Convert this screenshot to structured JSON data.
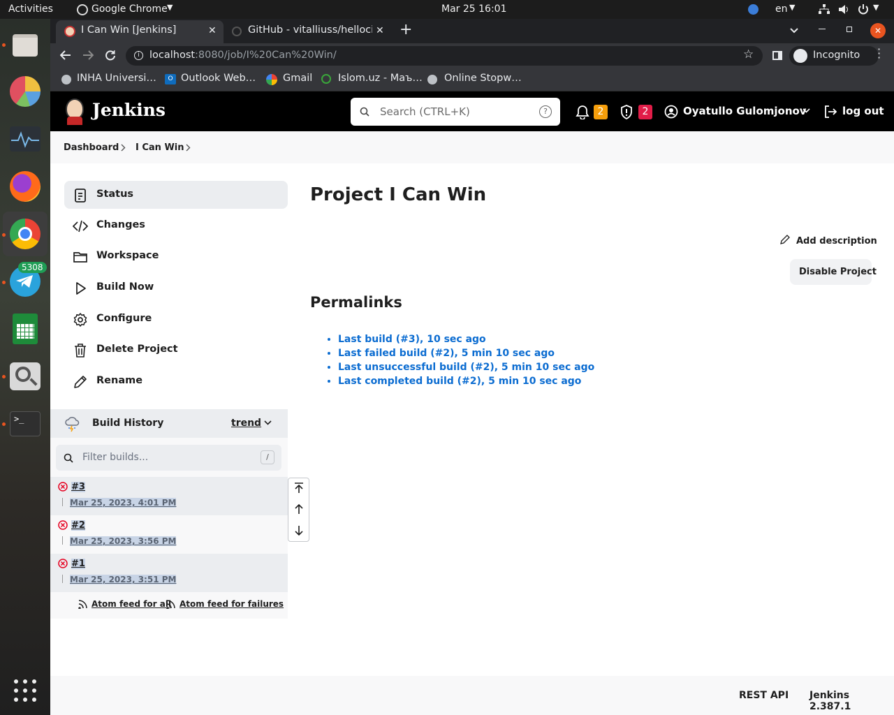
{
  "os_bar": {
    "activities": "Activities",
    "app_name": "Google Chrome",
    "datetime": "Mar 25  16:01",
    "lang": "en"
  },
  "dock": {
    "telegram_badge": "5308",
    "apps": [
      "files-icon",
      "pie-app-icon",
      "system-monitor-icon",
      "firefox-icon",
      "chrome-icon",
      "telegram-icon",
      "spreadsheet-icon",
      "image-viewer-icon",
      "terminal-icon",
      "app-grid-icon"
    ]
  },
  "browser": {
    "tabs": [
      {
        "label": "I Can Win [Jenkins]",
        "active": true
      },
      {
        "label": "GitHub - vitalliuss/helloci",
        "active": false
      }
    ],
    "url_host": "localhost",
    "url_rest": ":8080/job/I%20Can%20Win/",
    "profile": "Incognito",
    "bookmarks": [
      "INHA Universi…",
      "Outlook Web…",
      "Gmail",
      "Islom.uz - Маъ…",
      "Online Stopw…"
    ]
  },
  "jenkins": {
    "logo_text": "Jenkins",
    "search_placeholder": "Search (CTRL+K)",
    "notifications_count": "2",
    "security_count": "2",
    "user": "Oyatullo Gulomjonov",
    "logout": "log out",
    "breadcrumb": [
      "Dashboard",
      "I Can Win"
    ],
    "sidebar": [
      {
        "label": "Status",
        "icon": "status-icon",
        "active": true
      },
      {
        "label": "Changes",
        "icon": "code-icon"
      },
      {
        "label": "Workspace",
        "icon": "folder-icon"
      },
      {
        "label": "Build Now",
        "icon": "play-icon"
      },
      {
        "label": "Configure",
        "icon": "gear-icon"
      },
      {
        "label": "Delete Project",
        "icon": "trash-icon"
      },
      {
        "label": "Rename",
        "icon": "pencil-icon"
      }
    ],
    "build_history": {
      "title": "Build History",
      "trend": "trend",
      "filter_placeholder": "Filter builds...",
      "filter_shortcut": "/",
      "builds": [
        {
          "number": "#3",
          "date": "Mar 25, 2023, 4:01 PM",
          "status": "failed"
        },
        {
          "number": "#2",
          "date": "Mar 25, 2023, 3:56 PM",
          "status": "failed"
        },
        {
          "number": "#1",
          "date": "Mar 25, 2023, 3:51 PM",
          "status": "failed"
        }
      ],
      "feed_all": "Atom feed for all",
      "feed_failures": "Atom feed for failures"
    },
    "main": {
      "title": "Project I Can Win",
      "add_description": "Add description",
      "disable_project": "Disable Project",
      "permalinks_title": "Permalinks",
      "permalinks": [
        "Last build (#3), 10 sec ago",
        "Last failed build (#2), 5 min 10 sec ago",
        "Last unsuccessful build (#2), 5 min 10 sec ago",
        "Last completed build (#2), 5 min 10 sec ago"
      ]
    },
    "footer": {
      "rest_api": "REST API",
      "version": "Jenkins 2.387.1"
    }
  },
  "colors": {
    "jenkins_header": "#000000",
    "link_blue": "#0b6cd1",
    "badge_orange": "#f59e0b",
    "badge_red": "#e11d48",
    "fail_red": "#e6001f"
  }
}
